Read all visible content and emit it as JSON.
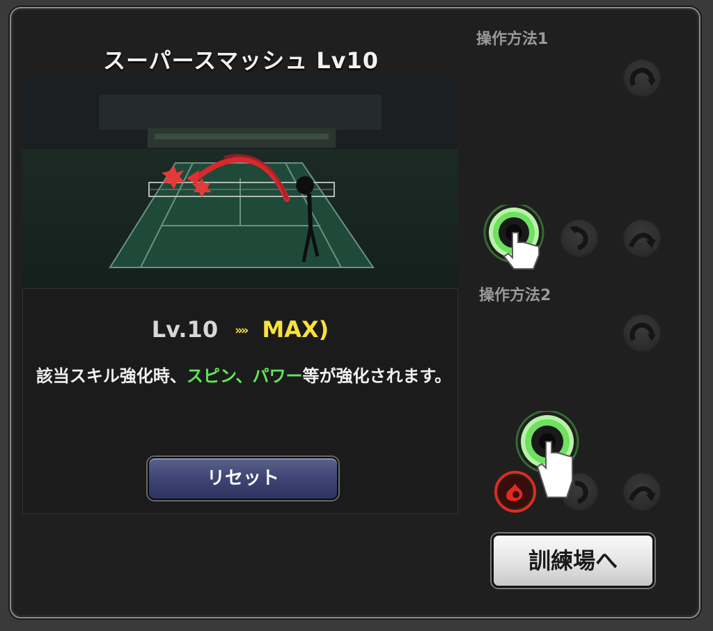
{
  "skill": {
    "title": "スーパースマッシュ Lv10"
  },
  "upgrade": {
    "current_level": "Lv.10",
    "arrow": "»»",
    "next_level": "MAX)"
  },
  "description": {
    "part1": "該当スキル強化時、",
    "highlight": "スピン、パワー",
    "part2": "等が強化されます。"
  },
  "buttons": {
    "reset_label": "リセット",
    "training_label": "訓練場へ"
  },
  "controls": {
    "method1_label": "操作方法1",
    "method2_label": "操作方法2"
  },
  "colors": {
    "highlight_green": "#5fe85a",
    "max_yellow": "#f8e23b",
    "tap_glow": "#7cf06a",
    "fire_red": "#e02a20"
  },
  "icons": [
    "swipe-arc-icon",
    "swipe-curve-icon",
    "tap-hand-icon",
    "fire-ball-icon"
  ]
}
